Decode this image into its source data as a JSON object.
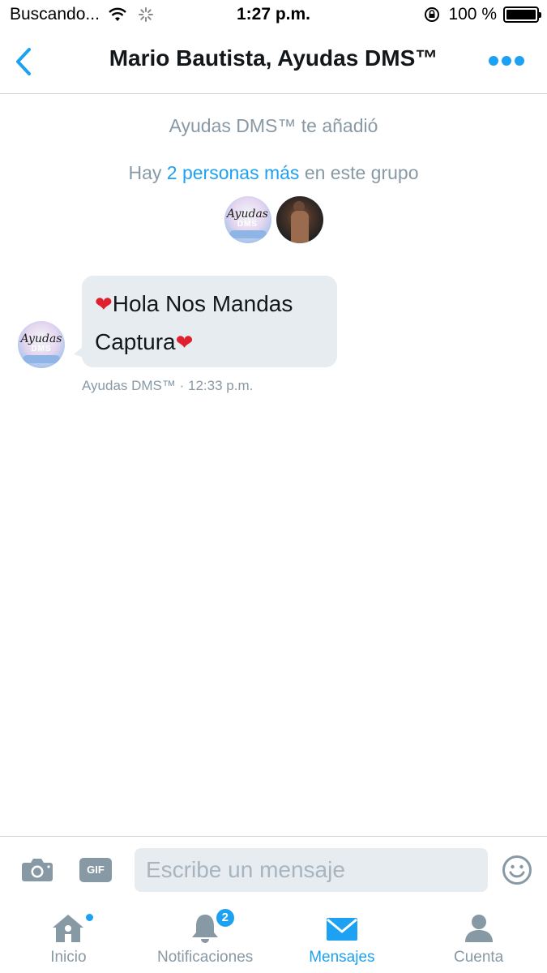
{
  "status_bar": {
    "carrier": "Buscando...",
    "time": "1:27 p.m.",
    "battery": "100 %"
  },
  "nav": {
    "title": "Mario Bautista, Ayudas DMS™"
  },
  "conversation": {
    "added_notice": "Ayudas DMS™ te añadió",
    "group_prefix": "Hay ",
    "group_link": "2 personas más",
    "group_suffix": " en este grupo",
    "avatar_logo_top": "Ayudas",
    "avatar_logo_bottom": "DMS",
    "message": {
      "heart_1": "❤",
      "text_1": "Hola Nos Mandas",
      "text_2": "Captura",
      "heart_2": "❤",
      "meta": "Ayudas DMS™ · 12:33 p.m."
    }
  },
  "composer": {
    "gif_label": "GIF",
    "placeholder": "Escribe un mensaje"
  },
  "tabs": [
    {
      "label": "Inicio",
      "icon": "home-icon"
    },
    {
      "label": "Notificaciones",
      "icon": "bell-icon",
      "badge": "2"
    },
    {
      "label": "Mensajes",
      "icon": "envelope-icon",
      "active": true
    },
    {
      "label": "Cuenta",
      "icon": "person-icon"
    }
  ],
  "colors": {
    "accent": "#1da1f2",
    "secondary_text": "#8899a6",
    "bubble": "#e6ecf0"
  }
}
